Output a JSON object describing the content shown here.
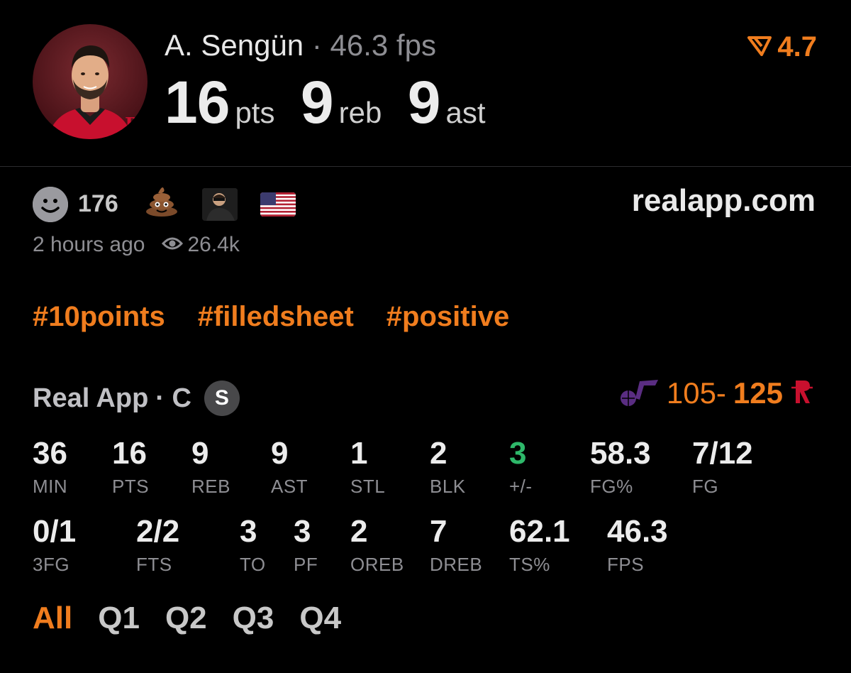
{
  "player": {
    "name": "A. Sengün",
    "separator": "·",
    "fps": "46.3 fps",
    "pts": "16",
    "pts_label": "pts",
    "reb": "9",
    "reb_label": "reb",
    "ast": "9",
    "ast_label": "ast"
  },
  "rating": {
    "value": "4.7",
    "icon": "real-logo-icon"
  },
  "social": {
    "reaction_count": "176",
    "time_ago": "2 hours ago",
    "views": "26.4k",
    "site": "realapp.com",
    "reaction_icons": [
      "smile-icon",
      "poop-emoji",
      "user-avatar",
      "us-flag-icon"
    ]
  },
  "tags": [
    "#10points",
    "#filledsheet",
    "#positive"
  ],
  "game": {
    "source": "Real App",
    "position": "· C",
    "badge": "S",
    "score_away": "105-",
    "score_home": "125",
    "away_team_icon": "jazz-logo-icon",
    "home_team_icon": "rockets-logo-icon"
  },
  "stats_row1": [
    {
      "v": "36",
      "l": "MIN"
    },
    {
      "v": "16",
      "l": "PTS"
    },
    {
      "v": "9",
      "l": "REB"
    },
    {
      "v": "9",
      "l": "AST"
    },
    {
      "v": "1",
      "l": "STL"
    },
    {
      "v": "2",
      "l": "BLK"
    },
    {
      "v": "3",
      "l": "+/-"
    },
    {
      "v": "58.3",
      "l": "FG%"
    },
    {
      "v": "7/12",
      "l": "FG"
    }
  ],
  "stats_row2": [
    {
      "v": "0/1",
      "l": "3FG"
    },
    {
      "v": "2/2",
      "l": "FTS"
    },
    {
      "v": "3",
      "l": "TO"
    },
    {
      "v": "3",
      "l": "PF"
    },
    {
      "v": "2",
      "l": "OREB"
    },
    {
      "v": "7",
      "l": "DREB"
    },
    {
      "v": "62.1",
      "l": "TS%"
    },
    {
      "v": "46.3",
      "l": "FPS"
    }
  ],
  "tabs": [
    "All",
    "Q1",
    "Q2",
    "Q3",
    "Q4"
  ],
  "colors": {
    "accent": "#f07d1e",
    "positive": "#2eb86a",
    "muted": "#8e8e93"
  }
}
